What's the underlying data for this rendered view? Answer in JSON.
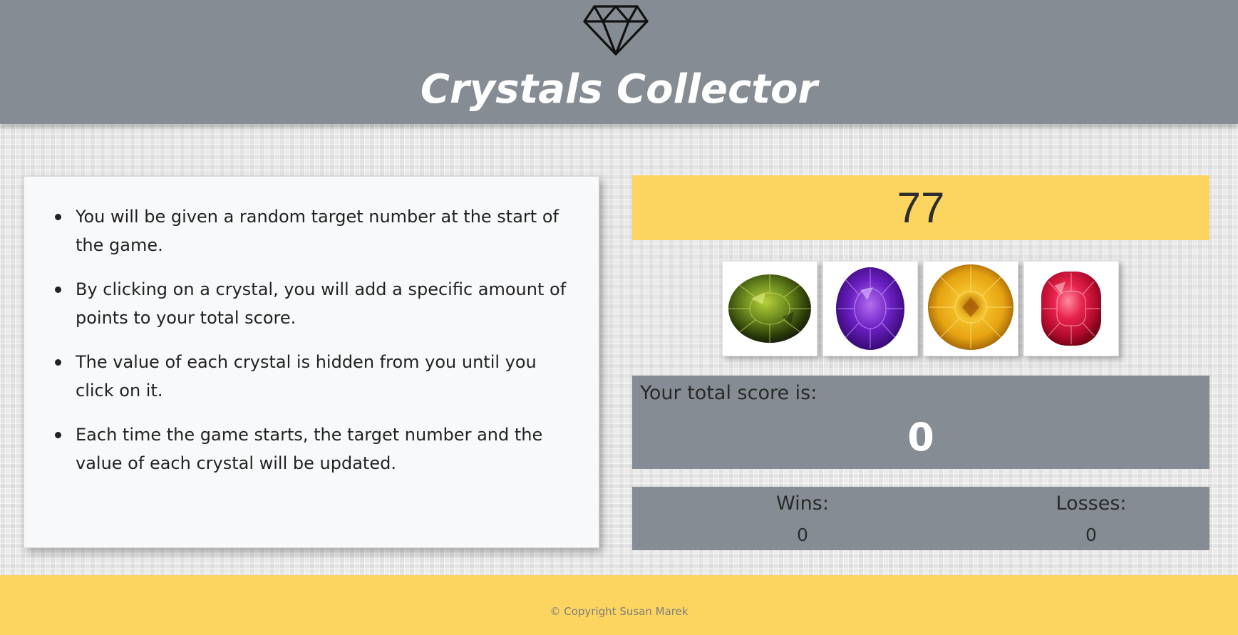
{
  "header": {
    "title": "Crystals Collector",
    "logo_icon": "diamond-outline-icon"
  },
  "instructions": {
    "items": [
      "You will be given a random target number at the start of the game.",
      "By clicking on a crystal, you will add a specific amount of points to your total score.",
      "The value of each crystal is hidden from you until you click on it.",
      "Each time the game starts, the target number and the value of each crystal will be updated."
    ]
  },
  "target": {
    "value": "77"
  },
  "crystals": [
    {
      "name": "green-crystal",
      "color": "#6b8a1e"
    },
    {
      "name": "purple-crystal",
      "color": "#6a1fc2"
    },
    {
      "name": "yellow-crystal",
      "color": "#e6a312"
    },
    {
      "name": "red-crystal",
      "color": "#d8163c"
    }
  ],
  "score": {
    "label": "Your total score is:",
    "value": "0"
  },
  "record": {
    "wins_label": "Wins:",
    "wins_value": "0",
    "losses_label": "Losses:",
    "losses_value": "0"
  },
  "footer": {
    "text": "© Copyright Susan Marek"
  },
  "colors": {
    "header_bg": "#858c94",
    "accent_yellow": "#fcd561",
    "panel_bg": "#f8f9fa"
  }
}
